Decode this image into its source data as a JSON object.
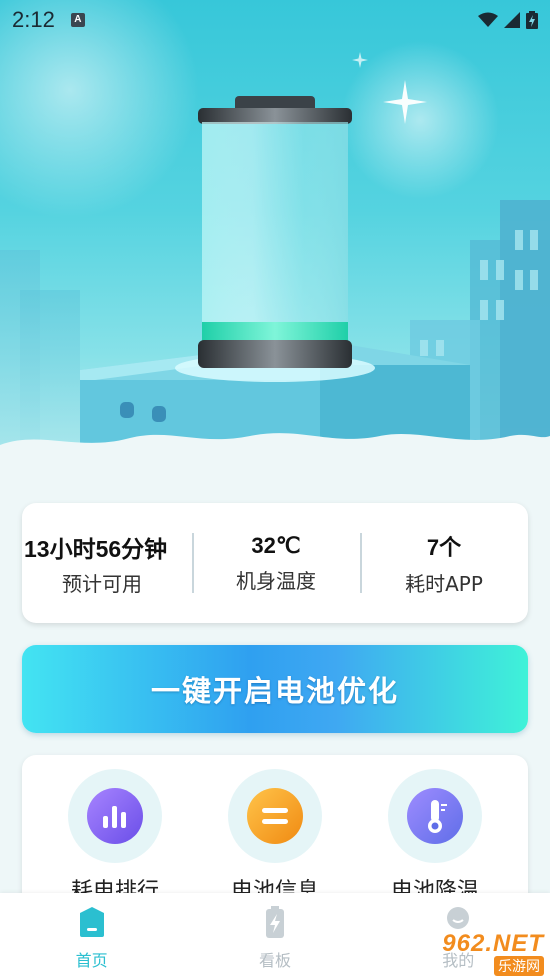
{
  "status_bar": {
    "time": "2:12",
    "indicator": "A"
  },
  "stats": {
    "remaining_time": "13小时56分钟",
    "remaining_label": "预计可用",
    "temperature": "32℃",
    "temperature_label": "机身温度",
    "apps": "7个",
    "apps_label": "耗时APP"
  },
  "battery_level": 0.08,
  "optimize_label": "一键开启电池优化",
  "features": [
    {
      "label": "耗电排行",
      "icon": "bar-chart-icon",
      "color": "#8a6cf0"
    },
    {
      "label": "电池信息",
      "icon": "battery-info-icon",
      "color": "#f6a02a"
    },
    {
      "label": "电池降温",
      "icon": "thermometer-icon",
      "color": "#7d6ff0"
    }
  ],
  "nav": [
    {
      "label": "首页",
      "icon": "home-icon",
      "active": true
    },
    {
      "label": "看板",
      "icon": "dashboard-icon",
      "active": false
    },
    {
      "label": "我的",
      "icon": "profile-icon",
      "active": false
    }
  ],
  "watermark": {
    "main": "962.NET",
    "sub": "乐游网"
  },
  "colors": {
    "accent": "#2bbfd0",
    "hero_top": "#37c7d9"
  }
}
